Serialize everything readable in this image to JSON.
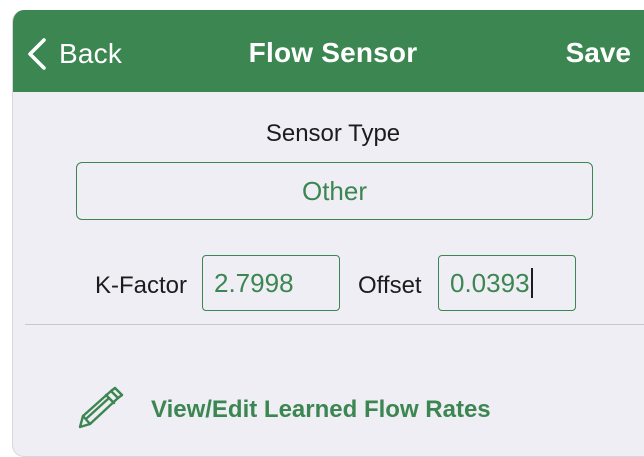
{
  "navbar": {
    "back_label": "Back",
    "title": "Flow Sensor",
    "save_label": "Save"
  },
  "sensor": {
    "type_label": "Sensor Type",
    "type_value": "Other",
    "k_factor_label": "K-Factor",
    "k_factor_value": "2.7998",
    "offset_label": "Offset",
    "offset_value": "0.0393"
  },
  "learned": {
    "label": "View/Edit Learned Flow Rates",
    "icon": "pencil-icon"
  },
  "colors": {
    "accent": "#3b8651",
    "background": "#efeef4",
    "text": "#1c1c1e"
  }
}
